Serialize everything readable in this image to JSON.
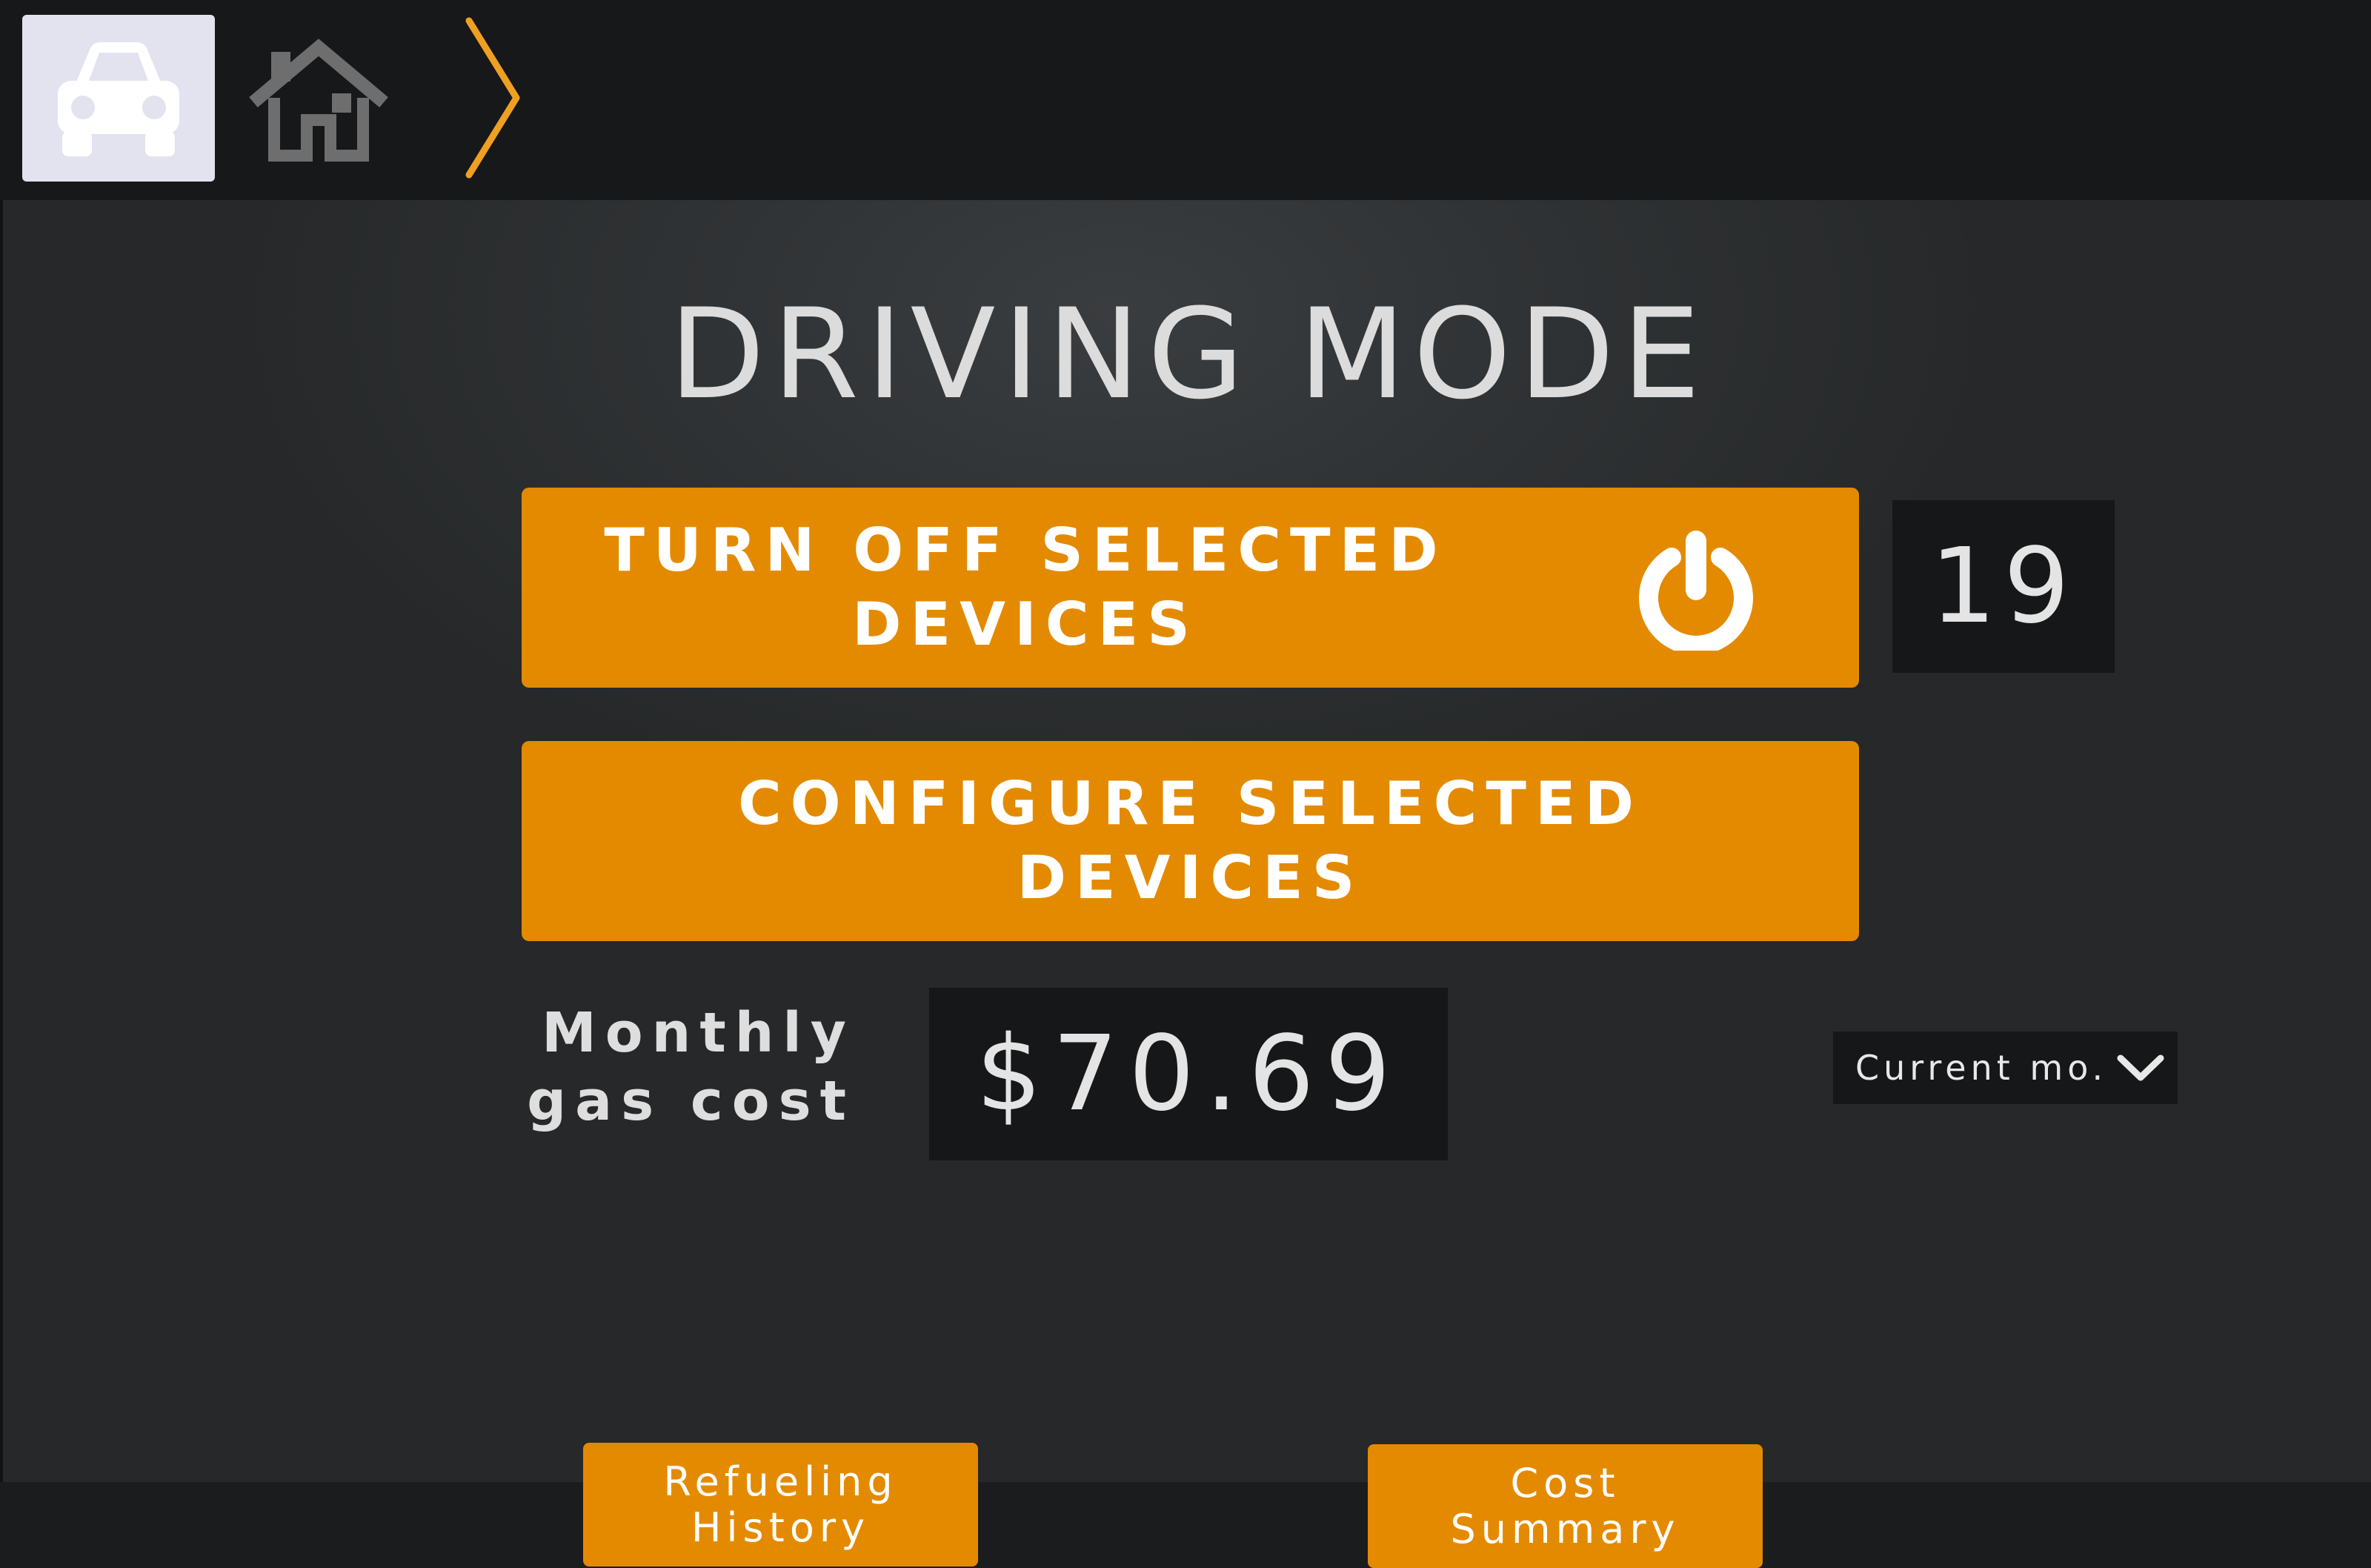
{
  "nav": {
    "tabs": [
      {
        "name": "car",
        "icon": "car-icon",
        "selected": true
      },
      {
        "name": "home",
        "icon": "home-icon",
        "selected": false
      }
    ],
    "breadcrumb_icon": "chevron-right-icon"
  },
  "page": {
    "title": "DRIVING MODE"
  },
  "actions": {
    "turn_off_label": "TURN OFF SELECTED\nDEVICES",
    "power_icon": "power-icon",
    "configure_label": "CONFIGURE SELECTED\nDEVICES",
    "selected_count": "19"
  },
  "gas": {
    "label": "Monthly\ngas cost",
    "value": "$70.69",
    "period_selected": "Current mo.",
    "period_icon": "chevron-down-icon"
  },
  "footer": {
    "refueling_label": "Refueling\nHistory",
    "cost_summary_label": "Cost\nSummary"
  },
  "colors": {
    "accent": "#e48a00",
    "breadcrumb": "#f0a020",
    "selected_tab": "#e3e3ef",
    "text": "#dcdcdc"
  }
}
